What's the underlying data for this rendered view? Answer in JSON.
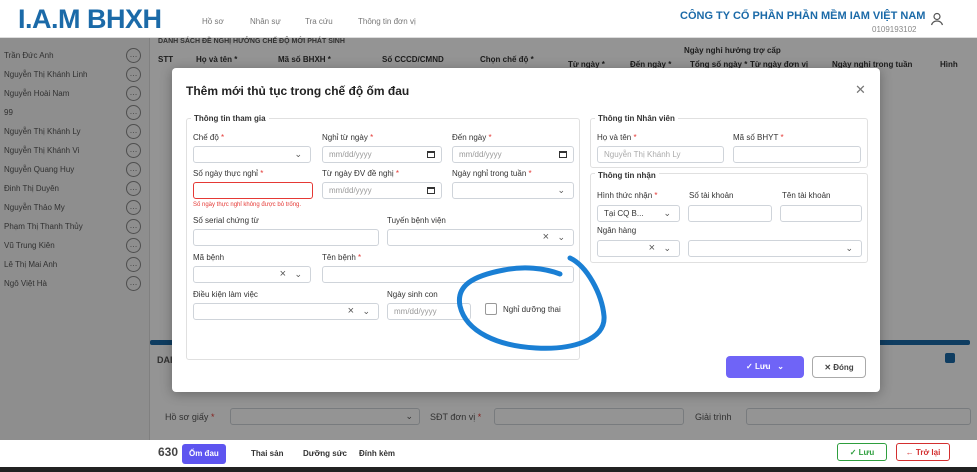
{
  "header": {
    "logo": "I.A.M BHXH",
    "nav": [
      "Hồ sơ",
      "Nhân sự",
      "Tra cứu",
      "Thông tin đơn vị"
    ],
    "company": "CÔNG TY CỔ PHẦN PHẦN MỀM IAM VIỆT NAM",
    "tax_code": "0109193102"
  },
  "sidebar": {
    "employees": [
      "Trần Đức Anh",
      "Nguyễn Thị Khánh Linh",
      "Nguyễn Hoài Nam",
      "99",
      "Nguyễn Thị Khánh Ly",
      "Nguyễn Thị Khánh Vi",
      "Nguyễn Quang Huy",
      "Đinh Thị Duyên",
      "Nguyễn Thảo My",
      "Phạm Thị Thanh Thủy",
      "Vũ Trung Kiên",
      "Lê Thị Mai Anh",
      "Ngô Việt Hà"
    ],
    "more_icon": "…"
  },
  "table": {
    "title": "DANH SÁCH ĐỀ NGHỊ HƯỞNG CHẾ ĐỘ MỚI PHÁT SINH",
    "columns": [
      "STT",
      "Họ và tên *",
      "Mã số BHXH *",
      "Số CCCD/CMND",
      "Chọn chế độ *",
      "Từ ngày *",
      "Đến ngày *",
      "Tổng số ngày *",
      "Từ ngày đơn vị",
      "Ngày nghỉ trong tuần",
      "Hình"
    ],
    "group_header": "Ngày nghỉ hưởng trợ cấp"
  },
  "modal": {
    "title": "Thêm mới thủ tục trong chế độ ốm đau",
    "participation": {
      "title": "Thông tin tham gia",
      "che_do": "Chế độ",
      "nghi_tu_ngay": "Nghỉ từ ngày",
      "den_ngay": "Đến ngày",
      "so_ngay_thuc_nghi": "Số ngày thực nghỉ",
      "tu_ngay_dv": "Từ ngày ĐV đề nghị",
      "ngay_nghi_tuan": "Ngày nghỉ trong tuần",
      "error": "Số ngày thực nghỉ không được bỏ trống.",
      "so_serial": "Số serial chứng từ",
      "tuyen_bv": "Tuyến bệnh viện",
      "ma_benh": "Mã bệnh",
      "ten_benh": "Tên bệnh",
      "dieu_kien": "Điều kiện làm việc",
      "ngay_sinh_con": "Ngày sinh con",
      "nghi_duong_thai": "Nghỉ dưỡng thai",
      "date_placeholder": "mm/dd/yyyy"
    },
    "employee": {
      "title": "Thông tin Nhân viên",
      "ho_ten": "Họ và tên",
      "ma_bhyt": "Mã số BHYT",
      "ho_ten_value": "Nguyễn Thị Khánh Ly"
    },
    "receive": {
      "title": "Thông tin nhận",
      "hinh_thuc": "Hình thức nhận",
      "so_tk": "Số tài khoản",
      "ten_tk": "Tên tài khoản",
      "hinh_thuc_value": "Tại CQ B...",
      "ngan_hang": "Ngân hàng"
    },
    "buttons": {
      "save": "Lưu",
      "close": "Đóng"
    }
  },
  "bottom": {
    "section": "DAI",
    "ho_so_giay": "Hồ sơ giấy",
    "sdt": "SĐT đơn vị",
    "giai_trinh": "Giải trình",
    "code": "630",
    "tabs": [
      "Ốm đau",
      "Thai sản",
      "Dưỡng sức",
      "Đính kèm"
    ],
    "save": "Lưu",
    "back": "Trở lại"
  },
  "colors": {
    "brand": "#1b6aa8",
    "primary": "#6f64f7",
    "error": "#e53935",
    "annotation": "#1a7fd4"
  }
}
